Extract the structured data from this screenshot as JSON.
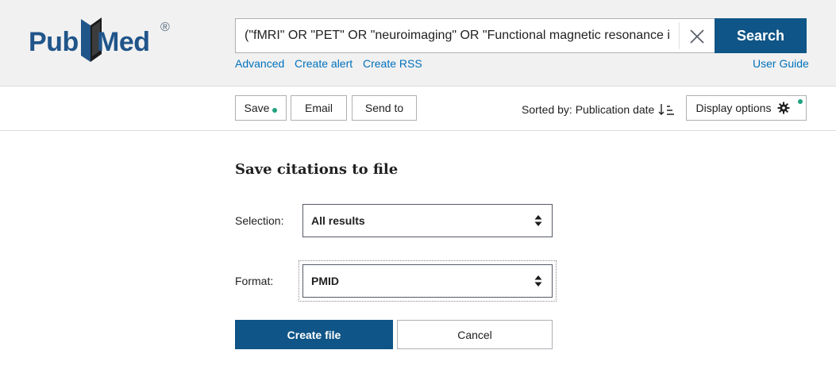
{
  "colors": {
    "brand_blue": "#0f5587",
    "link_blue": "#0071bc",
    "logo_blue": "#20558a",
    "indicator_green": "#20a480",
    "header_bg": "#f1f1f1"
  },
  "header": {
    "logo": {
      "part1": "Pub",
      "part2": "Med",
      "registered": "®",
      "icon": "book-icon"
    },
    "search": {
      "value": "(\"fMRI\" OR \"PET\" OR \"neuroimaging\" OR \"Functional magnetic resonance imaging\")",
      "clear_icon": "close-icon",
      "button_label": "Search"
    },
    "links": {
      "advanced": "Advanced",
      "create_alert": "Create alert",
      "create_rss": "Create RSS",
      "user_guide": "User Guide"
    }
  },
  "toolbar": {
    "save_label": "Save",
    "email_label": "Email",
    "send_to_label": "Send to",
    "sorted_by": "Sorted by: Publication date",
    "sort_icon": "sort-descending-icon",
    "display_options_label": "Display options",
    "display_icon": "gear-icon"
  },
  "save_panel": {
    "title": "Save citations to file",
    "selection_label": "Selection:",
    "selection_value": "All results",
    "format_label": "Format:",
    "format_value": "PMID",
    "create_button": "Create file",
    "cancel_button": "Cancel"
  }
}
